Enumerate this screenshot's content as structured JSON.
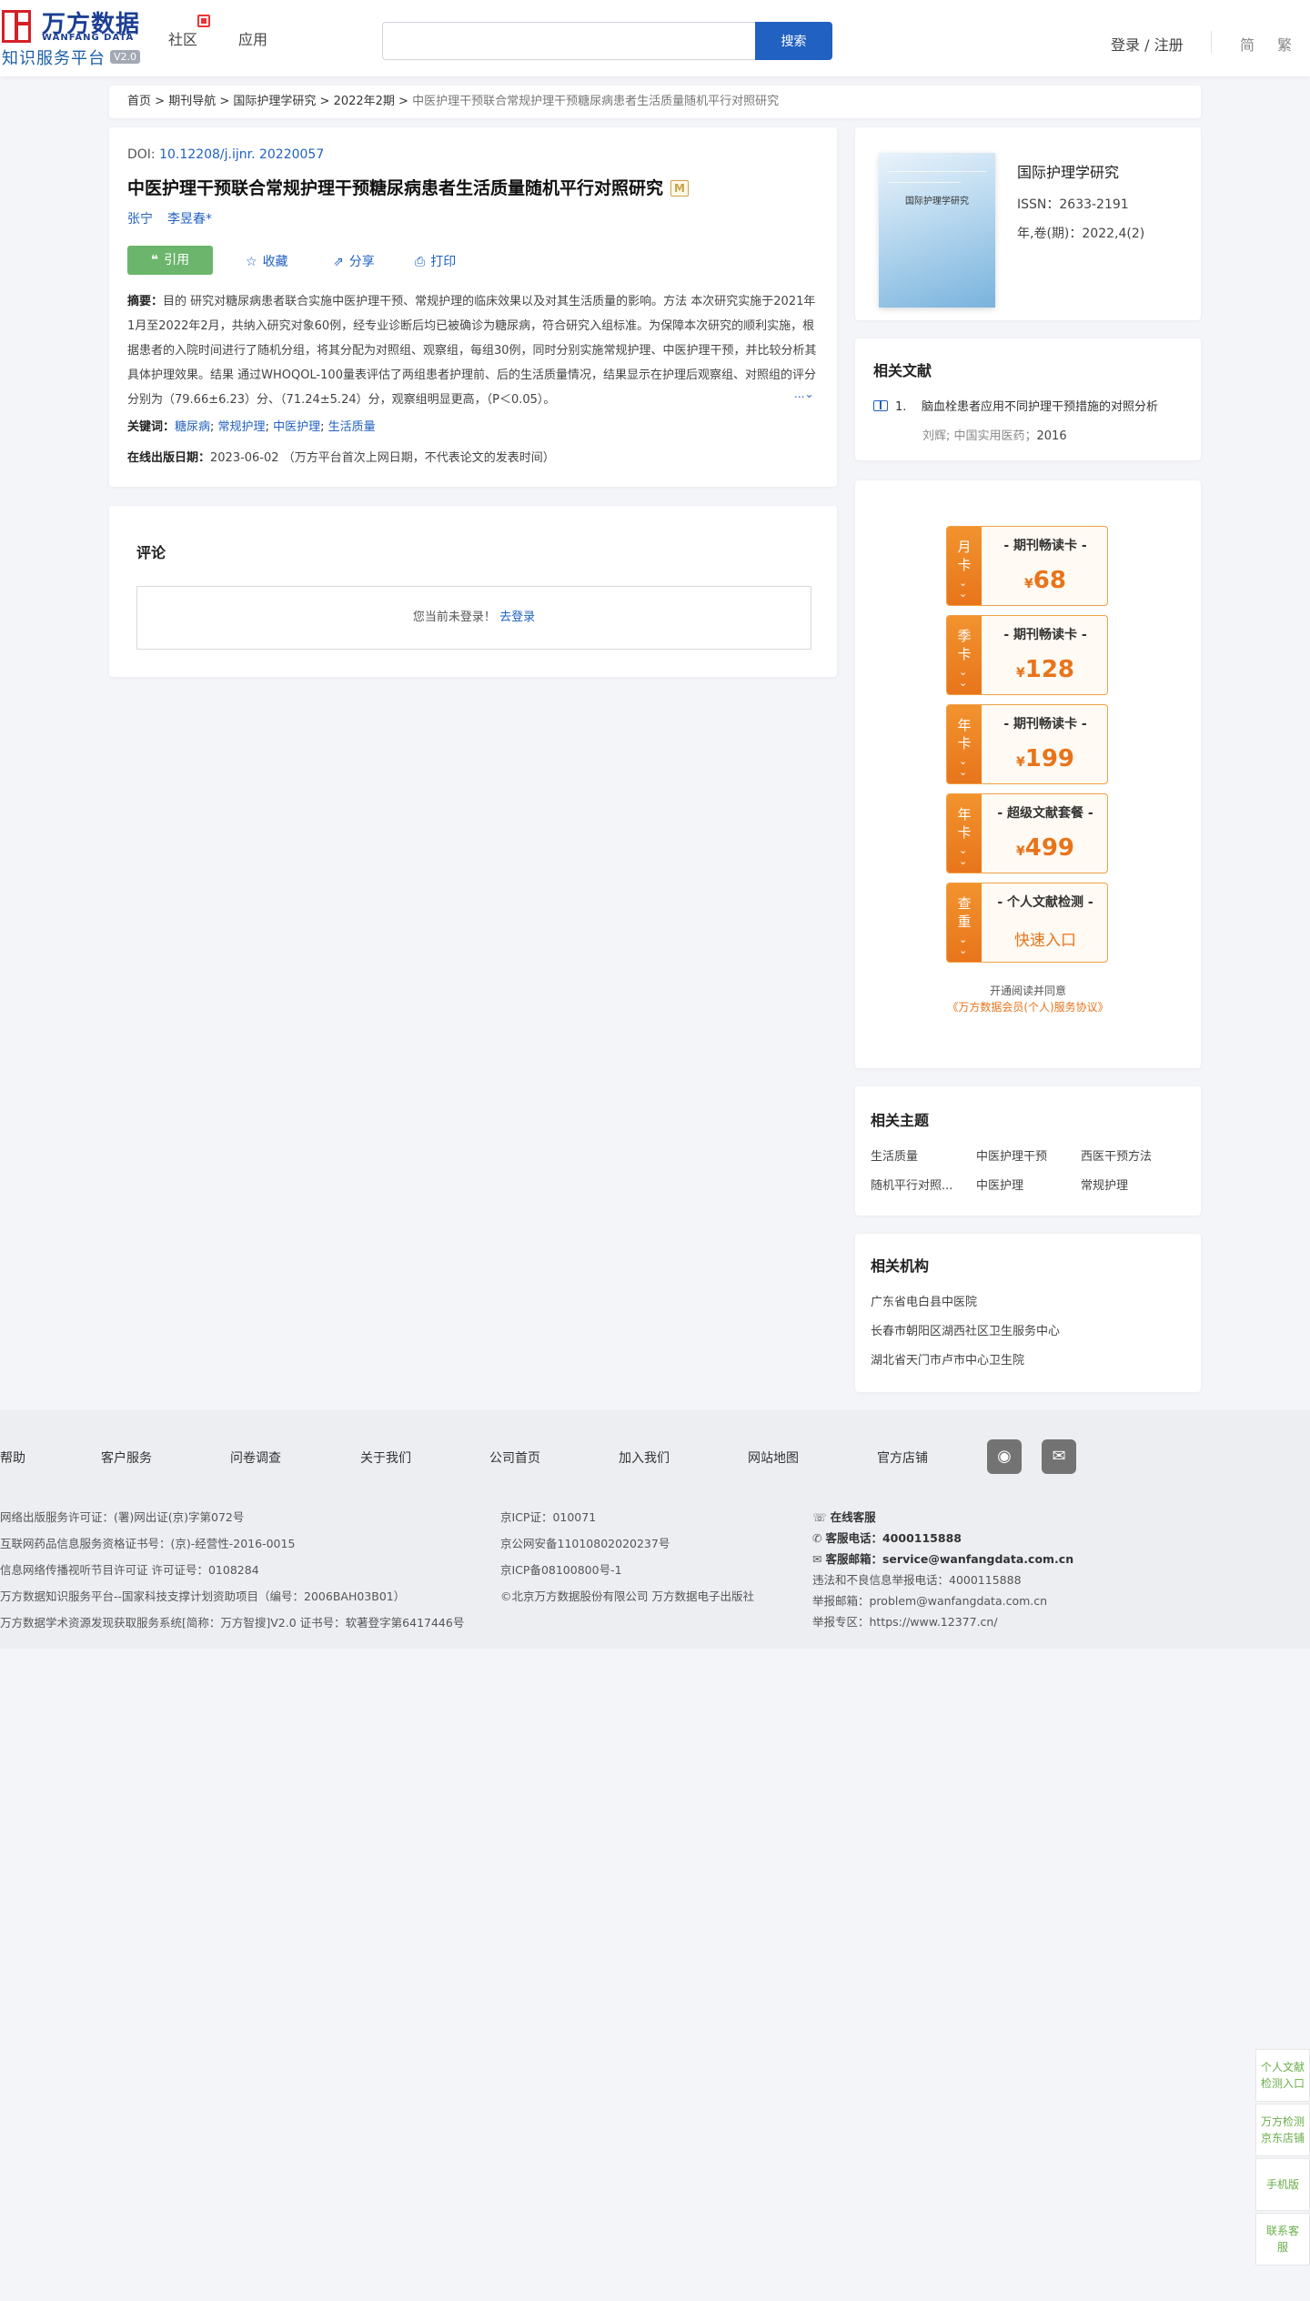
{
  "header": {
    "logo_cn": "万方数据",
    "logo_en": "WANFANG DATA",
    "logo_sub": "知识服务平台",
    "logo_ver": "V2.0",
    "nav": [
      "社区",
      "应用"
    ],
    "search_placeholder": "",
    "search_btn": "搜索",
    "login": "登录 / 注册",
    "lang_simplified": "简",
    "lang_traditional": "繁"
  },
  "breadcrumb": {
    "items": [
      "首页",
      "期刊导航",
      "国际护理学研究",
      "2022年2期"
    ],
    "sep": " > ",
    "current": "中医护理干预联合常规护理干预糖尿病患者生活质量随机平行对照研究"
  },
  "article": {
    "doi_label": "DOI: ",
    "doi": "10.12208/j.ijnr. 20220057",
    "title": "中医护理干预联合常规护理干预糖尿病患者生活质量随机平行对照研究",
    "m_badge": "M",
    "authors": [
      "张宁",
      "李昱春*"
    ],
    "btn_cite": "引用",
    "btn_collect": "收藏",
    "btn_share": "分享",
    "btn_print": "打印",
    "abstract_label": "摘要：",
    "abstract": "目的 研究对糖尿病患者联合实施中医护理干预、常规护理的临床效果以及对其生活质量的影响。方法 本次研究实施于2021年1月至2022年2月，共纳入研究对象60例，经专业诊断后均已被确诊为糖尿病，符合研究入组标准。为保障本次研究的顺利实施，根据患者的入院时间进行了随机分组，将其分配为对照组、观察组，每组30例，同时分别实施常规护理、中医护理干预，并比较分析其具体护理效果。结果 通过WHOQOL-100量表评估了两组患者护理前、后的生活质量情况，结果显示在护理后观察组、对照组的评分分别为（79.66±6.23）分、（71.24±5.24）分，观察组明显更高，（P＜0.05）。",
    "more": "...",
    "keywords_label": "关键词：",
    "keywords": [
      "糖尿病",
      "常规护理",
      "中医护理",
      "生活质量"
    ],
    "pubdate_label": "在线出版日期：",
    "pubdate": "2023-06-02",
    "pubdate_note": "（万方平台首次上网日期，不代表论文的发表时间）"
  },
  "comment": {
    "title": "评论",
    "not_logged": "您当前未登录！",
    "login_link": "去登录"
  },
  "journal": {
    "cover_title": "国际护理学研究",
    "name": "国际护理学研究",
    "issn": "ISSN：2633-2191",
    "volume": "年,卷(期)：2022,4(2)"
  },
  "related": {
    "title": "相关文献",
    "items": [
      {
        "num": "1.",
        "title": "脑血栓患者应用不同护理干预措施的对照分析",
        "authors": "刘辉; 中国实用医药；",
        "year": "2016"
      }
    ]
  },
  "promo": {
    "cards": [
      {
        "tag": "月卡",
        "name": "- 期刊畅读卡 -",
        "currency": "¥",
        "price": "68"
      },
      {
        "tag": "季卡",
        "name": "- 期刊畅读卡 -",
        "currency": "¥",
        "price": "128"
      },
      {
        "tag": "年卡",
        "name": "- 期刊畅读卡 -",
        "currency": "¥",
        "price": "199"
      },
      {
        "tag": "年卡",
        "name": "- 超级文献套餐 -",
        "currency": "¥",
        "price": "499"
      },
      {
        "tag": "查重",
        "name": "- 个人文献检测 -",
        "entry": "快速入口"
      }
    ],
    "agree_text": "开通阅读并同意",
    "agree_link": "《万方数据会员(个人)服务协议》"
  },
  "topics": {
    "title": "相关主题",
    "items": [
      "生活质量",
      "中医护理干预",
      "西医干预方法",
      "随机平行对照...",
      "中医护理",
      "常规护理"
    ]
  },
  "orgs": {
    "title": "相关机构",
    "items": [
      "广东省电白县中医院",
      "长春市朝阳区湖西社区卫生服务中心",
      "湖北省天门市卢市中心卫生院"
    ]
  },
  "footer": {
    "links": [
      "帮助",
      "客户服务",
      "问卷调查",
      "关于我们",
      "公司首页",
      "加入我们",
      "网站地图",
      "官方店铺"
    ],
    "col1": [
      "网络出版服务许可证：(署)网出证(京)字第072号",
      "互联网药品信息服务资格证书号：(京)-经营性-2016-0015",
      "信息网络传播视听节目许可证 许可证号：0108284",
      "万方数据知识服务平台--国家科技支撑计划资助项目（编号：2006BAH03B01）",
      "万方数据学术资源发现获取服务系统[简称：万方智搜]V2.0 证书号：软著登字第6417446号"
    ],
    "col2": [
      "京ICP证：010071",
      "京公网安备11010802020237号",
      "京ICP备08100800号-1",
      "©北京万方数据股份有限公司 万方数据电子出版社"
    ],
    "online_service": "在线客服",
    "phone_label": "客服电话：",
    "phone": "4000115888",
    "email_label": "客服邮箱：",
    "email": "service@wanfangdata.com.cn",
    "report_phone": "违法和不良信息举报电话：4000115888",
    "report_email": "举报邮箱：problem@wanfangdata.com.cn",
    "report_site": "举报专区：https://www.12377.cn/"
  },
  "float_bar": [
    "个人文献检测入口",
    "万方检测京东店铺",
    "手机版",
    "联系客服"
  ]
}
